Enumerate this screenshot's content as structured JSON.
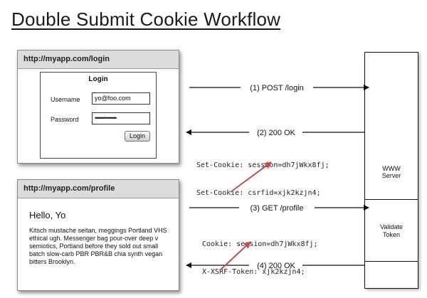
{
  "title": "Double Submit Cookie Workflow",
  "login_window": {
    "url": "http://myapp.com/login",
    "heading": "Login",
    "username_label": "Username",
    "username_value": "yo@foo.com",
    "password_label": "Password",
    "password_value": "••••••••••••••",
    "button_label": "Login"
  },
  "profile_window": {
    "url": "http://myapp.com/profile",
    "greeting": "Hello, Yo",
    "body": "Kitsch mustache seitan, meggings Portland VHS ethical ugh. Messenger bag pour-over deep v semiotics, Portland before they sold out small batch slow-carb PBR PBR&B chia synth vegan bitters Brooklyn."
  },
  "server": {
    "label": "WWW\nServer",
    "validate_label": "Validate\nToken"
  },
  "messages": [
    {
      "label": "(1) POST /login",
      "direction": "to-server"
    },
    {
      "label": "(2) 200 OK",
      "direction": "to-client"
    },
    {
      "label": "(3) GET /profile",
      "direction": "to-server"
    },
    {
      "label": "(4) 200 OK",
      "direction": "to-client"
    }
  ],
  "set_cookie_lines": [
    "Set-Cookie: session=dh7jWkx8fj;",
    "Set-Cookie: csrfid=xjk2kzjn4;"
  ],
  "request_header_lines": [
    "Cookie: session=dh7jWkx8fj;",
    "X-XSRF-Token: xjk2kzjn4;"
  ],
  "colors": {
    "highlight_arrow": "#c0504d",
    "line": "#111111"
  }
}
